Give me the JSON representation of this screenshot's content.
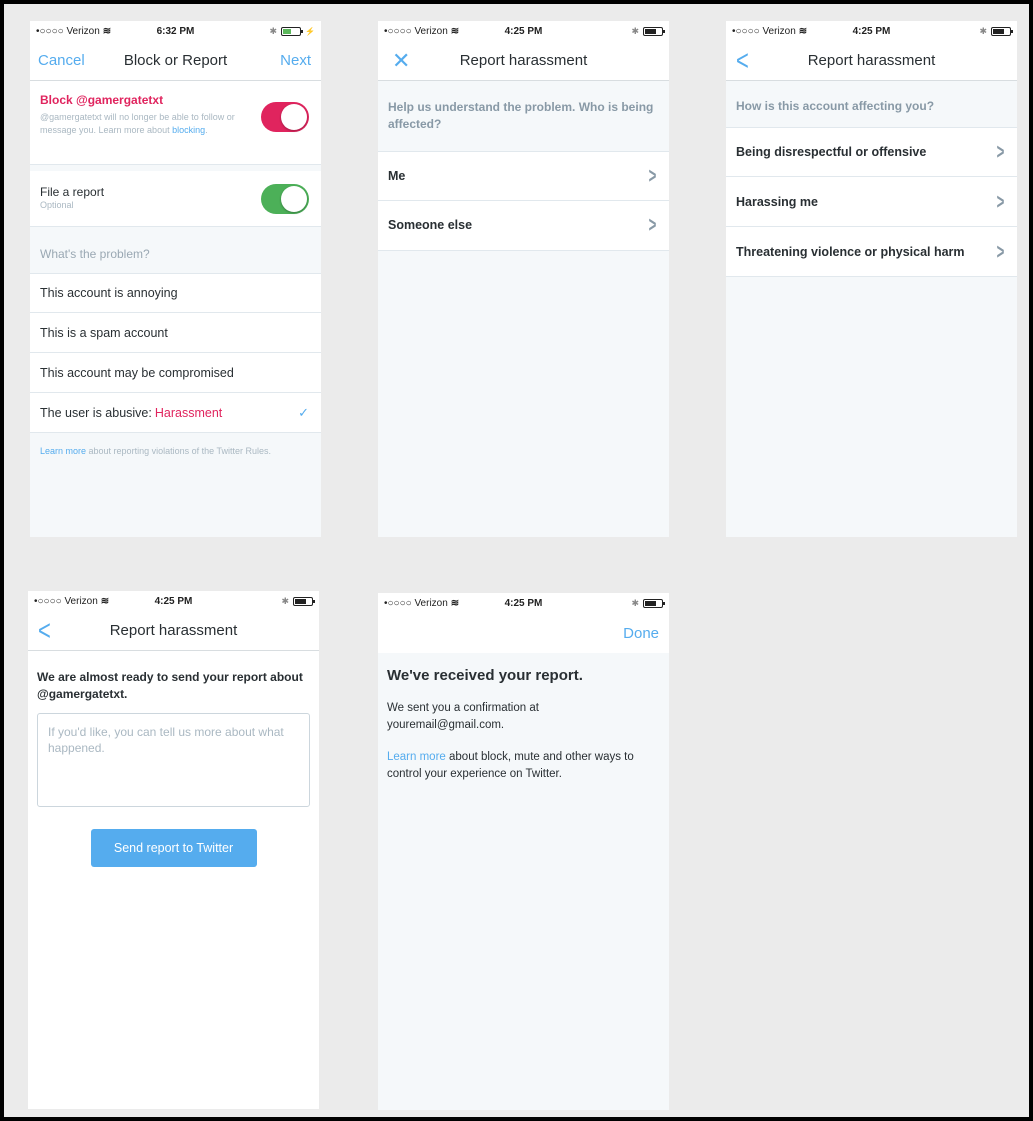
{
  "colors": {
    "accent": "#55acee",
    "danger": "#e0245e",
    "toggle_on": "#4cb058",
    "background": "#ebebeb"
  },
  "screen1": {
    "status": {
      "carrier": "•○○○○ Verizon",
      "time": "6:32 PM"
    },
    "nav": {
      "left": "Cancel",
      "title": "Block or Report",
      "right": "Next"
    },
    "block": {
      "title": "Block @gamergatetxt",
      "desc_pre": "@gamergatetxt will no longer be able to follow or message you. Learn more about ",
      "desc_link": "blocking",
      "desc_post": "."
    },
    "file_report": {
      "title": "File a report",
      "subtitle": "Optional"
    },
    "problem_header": "What's the problem?",
    "options": [
      "This account is annoying",
      "This is a spam account",
      "This account may be compromised"
    ],
    "selected_option": {
      "prefix": "The user is abusive: ",
      "highlight": "Harassment",
      "check": "✓"
    },
    "footer": {
      "link": "Learn more",
      "text": " about reporting violations of the Twitter Rules."
    }
  },
  "screen2": {
    "status": {
      "carrier": "•○○○○ Verizon",
      "time": "4:25 PM"
    },
    "nav": {
      "title": "Report harassment"
    },
    "prompt": "Help us understand the problem. Who is being affected?",
    "options": [
      "Me",
      "Someone else"
    ]
  },
  "screen3": {
    "status": {
      "carrier": "•○○○○ Verizon",
      "time": "4:25 PM"
    },
    "nav": {
      "title": "Report harassment"
    },
    "prompt": "How is this account affecting you?",
    "options": [
      "Being disrespectful or offensive",
      "Harassing me",
      "Threatening violence or physical harm"
    ]
  },
  "screen4": {
    "status": {
      "carrier": "•○○○○ Verizon",
      "time": "4:25 PM"
    },
    "nav": {
      "title": "Report harassment"
    },
    "heading": "We are almost ready to send your report about @gamergatetxt.",
    "textarea_placeholder": "If you'd like, you can tell us more about what happened.",
    "send_button": "Send report to Twitter"
  },
  "screen5": {
    "status": {
      "carrier": "•○○○○ Verizon",
      "time": "4:25 PM"
    },
    "nav": {
      "right": "Done"
    },
    "heading": "We've received your report.",
    "confirm_text": "We sent you a confirmation at youremail@gmail.com.",
    "learn_link": "Learn more",
    "learn_text": " about block, mute and other ways to control your experience on Twitter."
  }
}
